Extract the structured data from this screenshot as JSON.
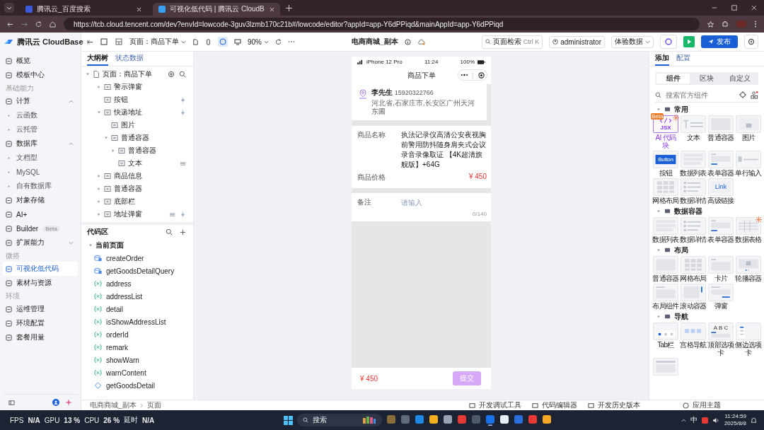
{
  "browser": {
    "tabs": [
      {
        "title": "腾讯云_百度搜索",
        "selected": false
      },
      {
        "title": "可视化低代码 | 腾讯云 CloudB",
        "selected": true
      }
    ],
    "url": "https://tcb.cloud.tencent.com/dev?envId=lowcode-3guv3lzmb170c21b#/lowcode/editor?appId=app-Y6dPPiqd&mainAppId=app-Y6dPPiqd"
  },
  "toolbar": {
    "page_select": "页面：商品下单",
    "zoom": "90%",
    "app_name": "电商商城_副本",
    "search": "页面检索",
    "shortcut": "Ctrl K",
    "user": "administrator",
    "data_mode": "体验数据",
    "publish": "发布"
  },
  "sidebar": {
    "logo": "腾讯云 CloudBase",
    "items": [
      {
        "kind": "item",
        "label": "概览",
        "selected": false
      },
      {
        "kind": "item",
        "label": "模板中心",
        "selected": false
      },
      {
        "kind": "section",
        "label": "基础能力"
      },
      {
        "kind": "group",
        "label": "计算",
        "selected": false,
        "expanded": true
      },
      {
        "kind": "sub",
        "label": "云函数",
        "selected": false
      },
      {
        "kind": "sub",
        "label": "云托管",
        "selected": false
      },
      {
        "kind": "group",
        "label": "数据库",
        "selected": false,
        "expanded": true
      },
      {
        "kind": "sub",
        "label": "文档型",
        "selected": false
      },
      {
        "kind": "sub",
        "label": "MySQL",
        "selected": false
      },
      {
        "kind": "sub",
        "label": "自有数据库",
        "selected": false
      },
      {
        "kind": "item",
        "label": "对象存储",
        "selected": false
      },
      {
        "kind": "item",
        "label": "AI+",
        "selected": false
      },
      {
        "kind": "item",
        "label": "Builder",
        "selected": false,
        "badge": "Beta"
      },
      {
        "kind": "group",
        "label": "扩展能力",
        "selected": false,
        "expanded": false
      },
      {
        "kind": "section",
        "label": "微搭"
      },
      {
        "kind": "item",
        "label": "可视化低代码",
        "selected": true
      },
      {
        "kind": "item",
        "label": "素材与资源",
        "selected": false
      },
      {
        "kind": "section",
        "label": "环境"
      },
      {
        "kind": "item",
        "label": "运维管理",
        "selected": false
      },
      {
        "kind": "item",
        "label": "环境配置",
        "selected": false
      },
      {
        "kind": "item",
        "label": "套餐用量",
        "selected": false
      }
    ]
  },
  "outline": {
    "tabs": [
      {
        "label": "大纲树",
        "selected": true
      },
      {
        "label": "状态数据",
        "selected": false
      }
    ],
    "root": {
      "label": "页面：商品下单",
      "expanded": true,
      "children": [
        {
          "label": "警示弹窗",
          "kind": "branch",
          "expanded": false,
          "event": false,
          "bound": false
        },
        {
          "label": "按钮",
          "kind": "leaf",
          "event": true,
          "bound": false
        },
        {
          "label": "快递地址",
          "kind": "branch",
          "expanded": true,
          "event": true,
          "bound": false,
          "children": [
            {
              "label": "图片",
              "kind": "leaf",
              "event": false,
              "bound": false
            },
            {
              "label": "普通容器",
              "kind": "branch",
              "expanded": true,
              "event": false,
              "bound": false,
              "children": [
                {
                  "label": "普通容器",
                  "kind": "branch",
                  "expanded": false,
                  "event": false,
                  "bound": false
                },
                {
                  "label": "文本",
                  "kind": "leaf",
                  "event": false,
                  "bound": true
                }
              ]
            }
          ]
        },
        {
          "label": "商品信息",
          "kind": "branch",
          "expanded": false,
          "event": false,
          "bound": false
        },
        {
          "label": "普通容器",
          "kind": "branch",
          "expanded": false,
          "event": false,
          "bound": false
        },
        {
          "label": "底部栏",
          "kind": "branch",
          "expanded": false,
          "event": false,
          "bound": false
        },
        {
          "label": "地址弹窗",
          "kind": "branch",
          "expanded": false,
          "event": true,
          "bound": true
        }
      ]
    }
  },
  "code": {
    "title": "代码区",
    "group": "当前页面",
    "expanded": true,
    "items": [
      {
        "kind": "query",
        "name": "createOrder"
      },
      {
        "kind": "query",
        "name": "getGoodsDetailQuery"
      },
      {
        "kind": "variable",
        "name": "address"
      },
      {
        "kind": "variable",
        "name": "addressList"
      },
      {
        "kind": "variable",
        "name": "detail"
      },
      {
        "kind": "variable",
        "name": "isShowAddressList"
      },
      {
        "kind": "variable",
        "name": "orderId"
      },
      {
        "kind": "variable",
        "name": "remark"
      },
      {
        "kind": "variable",
        "name": "showWarn"
      },
      {
        "kind": "variable",
        "name": "warnContent"
      },
      {
        "kind": "function",
        "name": "getGoodsDetail"
      }
    ]
  },
  "phone": {
    "device": "iPhone 12 Pro",
    "time": "11:24",
    "battery": "100%",
    "title": "商品下单",
    "address": {
      "name": "李先生",
      "phone": "15920322766",
      "text": "河北省,石家庄市,长安区广州天河东圃"
    },
    "product": [
      {
        "label": "商品名称",
        "value": "执法记录仪高清公安夜视胸前警用防抖随身肩夹式会议录音录像取证 【4K超清旗舰版】+64G",
        "kind": "text"
      },
      {
        "label": "商品价格",
        "value": "¥ 450",
        "kind": "price"
      }
    ],
    "remark": {
      "label": "备注",
      "placeholder": "请输入",
      "counter": "0/140"
    },
    "footer": {
      "price": "¥ 450",
      "submit": "提交"
    }
  },
  "panel": {
    "tabs": [
      {
        "label": "添加",
        "selected": true
      },
      {
        "label": "配置",
        "selected": false
      }
    ],
    "segments": [
      {
        "label": "组件",
        "selected": true
      },
      {
        "label": "区块",
        "selected": false
      },
      {
        "label": "自定义",
        "selected": false
      }
    ],
    "search_placeholder": "搜索官方组件",
    "groups": [
      {
        "title": "常用",
        "expanded": true,
        "items": [
          {
            "label": "AI 代码块",
            "kind": "jsx",
            "thumb_text": "JSX",
            "badge": "Beta",
            "flagged": true
          },
          {
            "label": "文本",
            "kind": "text",
            "flagged": false
          },
          {
            "label": "普通容器",
            "kind": "box",
            "flagged": false
          },
          {
            "label": "图片",
            "kind": "image",
            "flagged": false
          },
          {
            "label": "按钮",
            "kind": "button",
            "thumb_text": "Button",
            "flagged": false
          },
          {
            "label": "数据列表",
            "kind": "list",
            "flagged": false
          },
          {
            "label": "表单容器",
            "kind": "form",
            "flagged": false
          },
          {
            "label": "单行输入",
            "kind": "input",
            "flagged": false
          },
          {
            "label": "网格布局",
            "kind": "grid",
            "flagged": false
          },
          {
            "label": "数据详情",
            "kind": "detail",
            "flagged": false
          },
          {
            "label": "高级链接",
            "kind": "link",
            "thumb_text": "Link",
            "flagged": false
          }
        ]
      },
      {
        "title": "数据容器",
        "expanded": true,
        "items": [
          {
            "label": "数据列表",
            "kind": "list",
            "flagged": false
          },
          {
            "label": "数据详情",
            "kind": "detail",
            "flagged": false
          },
          {
            "label": "表单容器",
            "kind": "form",
            "flagged": false
          },
          {
            "label": "数据表格",
            "kind": "table",
            "flagged": true
          }
        ]
      },
      {
        "title": "布局",
        "expanded": true,
        "items": [
          {
            "label": "普通容器",
            "kind": "box",
            "flagged": false
          },
          {
            "label": "网格布局",
            "kind": "grid",
            "flagged": false
          },
          {
            "label": "卡片",
            "kind": "card",
            "flagged": false
          },
          {
            "label": "轮播容器",
            "kind": "carousel",
            "flagged": false
          },
          {
            "label": "布局组件",
            "kind": "layout",
            "flagged": false
          },
          {
            "label": "滚动容器",
            "kind": "scroll",
            "flagged": false
          },
          {
            "label": "弹窗",
            "kind": "modal",
            "flagged": false
          }
        ]
      },
      {
        "title": "导航",
        "expanded": true,
        "items": [
          {
            "label": "Tab栏",
            "kind": "tabbar",
            "flagged": false
          },
          {
            "label": "宫格导航",
            "kind": "gridnav",
            "flagged": false
          },
          {
            "label": "顶部选项卡",
            "kind": "toptabs",
            "thumb_text": "A B C",
            "flagged": false
          },
          {
            "label": "侧边选项卡",
            "kind": "sidetabs",
            "flagged": false
          },
          {
            "kind": "bar",
            "flagged": false
          }
        ]
      }
    ],
    "theme": "应用主题"
  },
  "status": {
    "breadcrumb": [
      "电商商城_副本",
      "页面"
    ],
    "tools": [
      "开发调试工具",
      "代码编辑器",
      "开发历史版本"
    ]
  },
  "taskbar": {
    "perf": [
      {
        "label": "FPS",
        "value": "N/A"
      },
      {
        "label": "GPU",
        "value": "13 %"
      },
      {
        "label": "CPU",
        "value": "26 %"
      },
      {
        "label": "延时",
        "value": "N/A"
      }
    ],
    "search": "搜索",
    "ime": "中",
    "time": "11:24:59",
    "date": "2025/8/8"
  }
}
